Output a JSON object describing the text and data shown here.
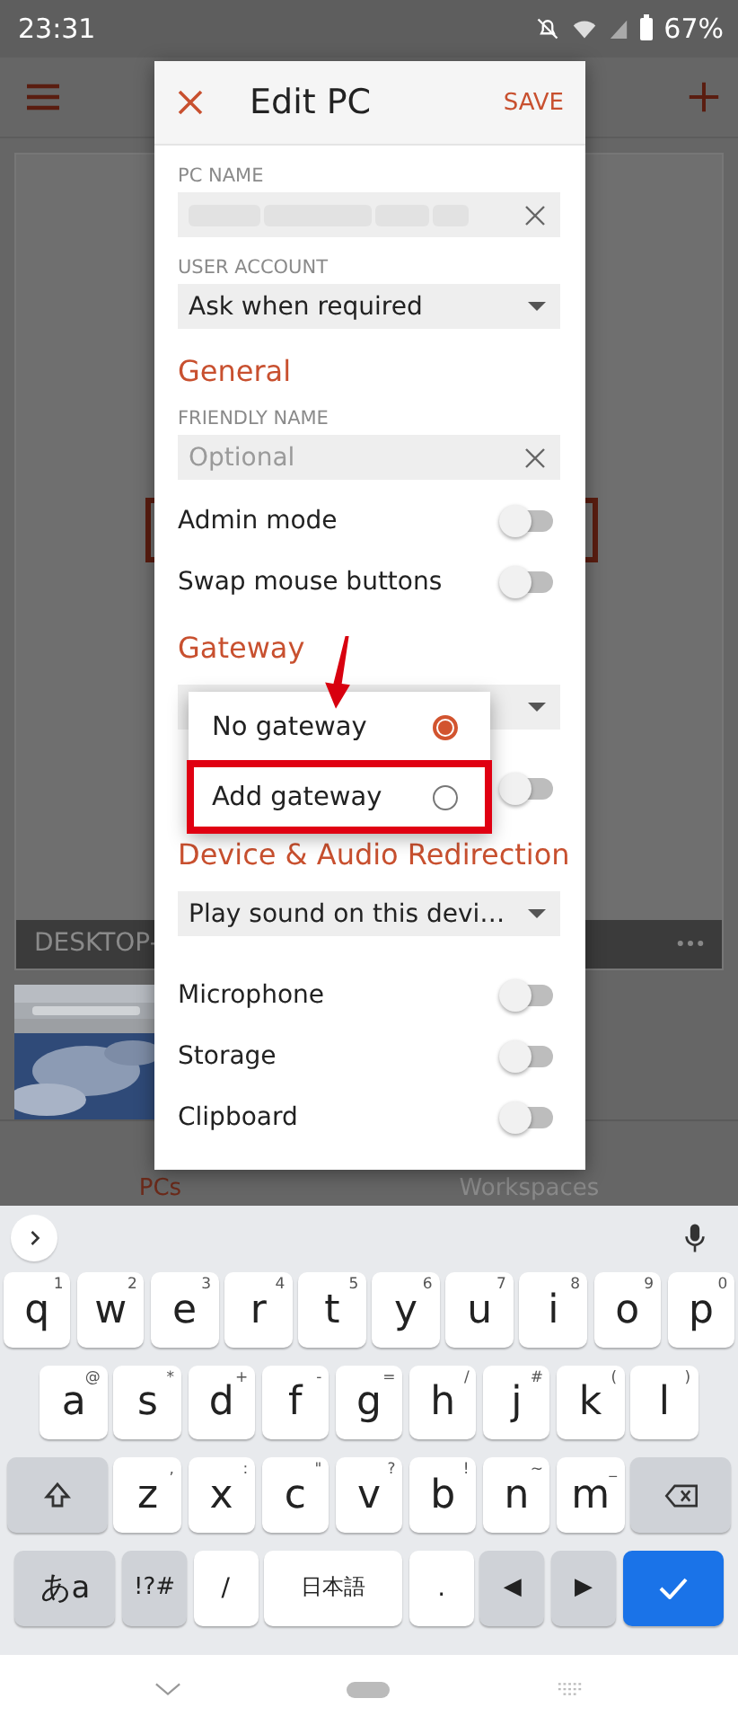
{
  "status_bar": {
    "time": "23:31",
    "battery": "67%"
  },
  "app": {
    "card_title": "DESKTOP-",
    "tabs": [
      {
        "label": "PCs",
        "selected": true
      },
      {
        "label": "Workspaces",
        "selected": false
      }
    ]
  },
  "dialog": {
    "title": "Edit PC",
    "save": "SAVE",
    "items": [
      {
        "kind": "label",
        "text": "PC NAME"
      },
      {
        "kind": "field",
        "blurred": true
      },
      {
        "kind": "label",
        "text": "USER ACCOUNT"
      },
      {
        "kind": "dropdown",
        "value": "Ask when required"
      },
      {
        "kind": "heading",
        "text": "General"
      },
      {
        "kind": "label",
        "text": "FRIENDLY NAME"
      },
      {
        "kind": "field",
        "placeholder": "Optional"
      },
      {
        "kind": "toggle",
        "text": "Admin mode",
        "on": false
      },
      {
        "kind": "toggle",
        "text": "Swap mouse buttons",
        "on": false
      },
      {
        "kind": "heading",
        "text": "Gateway"
      },
      {
        "kind": "dropdown"
      },
      {
        "kind": "toggle",
        "on": false
      },
      {
        "kind": "heading",
        "text": "Device & Audio Redirection"
      },
      {
        "kind": "dropdown",
        "value": "Play sound on this devi…"
      },
      {
        "kind": "toggle",
        "text": "Microphone",
        "on": false
      },
      {
        "kind": "toggle",
        "text": "Storage",
        "on": false
      },
      {
        "kind": "toggle",
        "text": "Clipboard",
        "on": false
      }
    ]
  },
  "gateway_menu": {
    "options": [
      {
        "label": "No gateway",
        "selected": true,
        "highlighted": false
      },
      {
        "label": "Add gateway",
        "selected": false,
        "highlighted": true
      }
    ]
  },
  "keyboard": {
    "rows": [
      {
        "keys": [
          {
            "kind": "char",
            "key": "q",
            "hint": "1"
          },
          {
            "kind": "char",
            "key": "w",
            "hint": "2"
          },
          {
            "kind": "char",
            "key": "e",
            "hint": "3"
          },
          {
            "kind": "char",
            "key": "r",
            "hint": "4"
          },
          {
            "kind": "char",
            "key": "t",
            "hint": "5"
          },
          {
            "kind": "char",
            "key": "y",
            "hint": "6"
          },
          {
            "kind": "char",
            "key": "u",
            "hint": "7"
          },
          {
            "kind": "char",
            "key": "i",
            "hint": "8"
          },
          {
            "kind": "char",
            "key": "o",
            "hint": "9"
          },
          {
            "kind": "char",
            "key": "p",
            "hint": "0"
          }
        ]
      },
      {
        "keys": [
          {
            "kind": "char",
            "key": "a",
            "hint": "@"
          },
          {
            "kind": "char",
            "key": "s",
            "hint": "*"
          },
          {
            "kind": "char",
            "key": "d",
            "hint": "+"
          },
          {
            "kind": "char",
            "key": "f",
            "hint": "-"
          },
          {
            "kind": "char",
            "key": "g",
            "hint": "="
          },
          {
            "kind": "char",
            "key": "h",
            "hint": "/"
          },
          {
            "kind": "char",
            "key": "j",
            "hint": "#"
          },
          {
            "kind": "char",
            "key": "k",
            "hint": "("
          },
          {
            "kind": "char",
            "key": "l",
            "hint": ")"
          }
        ]
      },
      {
        "keys": [
          {
            "kind": "shift"
          },
          {
            "kind": "char",
            "key": "z",
            "hint": ","
          },
          {
            "kind": "char",
            "key": "x",
            "hint": ":"
          },
          {
            "kind": "char",
            "key": "c",
            "hint": "\""
          },
          {
            "kind": "char",
            "key": "v",
            "hint": "?"
          },
          {
            "kind": "char",
            "key": "b",
            "hint": "!"
          },
          {
            "kind": "char",
            "key": "n",
            "hint": "~"
          },
          {
            "kind": "char",
            "key": "m",
            "hint": "_"
          },
          {
            "kind": "backspace"
          }
        ]
      },
      {
        "keys": [
          {
            "kind": "mode",
            "key": "あa"
          },
          {
            "kind": "fn",
            "key": "!?#"
          },
          {
            "kind": "char",
            "key": "/"
          },
          {
            "kind": "space",
            "key": "日本語"
          },
          {
            "kind": "char",
            "key": "."
          },
          {
            "kind": "fn",
            "key": "◀"
          },
          {
            "kind": "fn",
            "key": "▶"
          },
          {
            "kind": "enter"
          }
        ]
      }
    ]
  }
}
